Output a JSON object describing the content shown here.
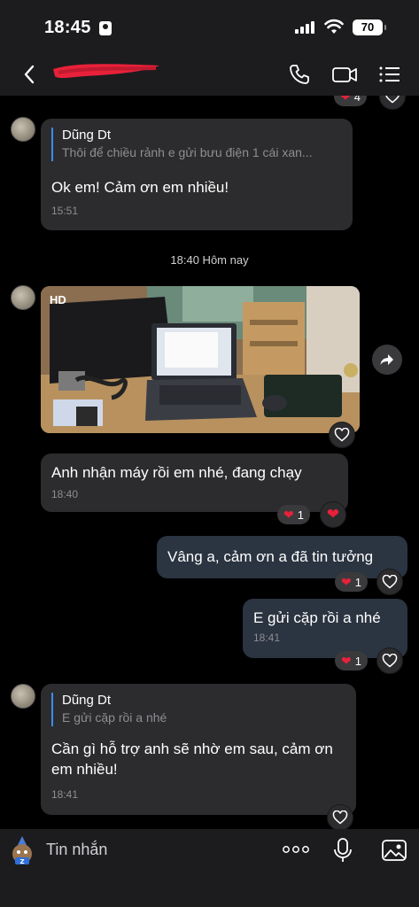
{
  "status_bar": {
    "time": "18:45",
    "battery": "70"
  },
  "header": {
    "back_icon": "chevron-left-icon",
    "contact_name": "",
    "call_icon": "phone-icon",
    "video_icon": "video-icon",
    "menu_icon": "list-icon"
  },
  "top_partial": {
    "reaction_count": "4"
  },
  "messages": [
    {
      "quote_name": "Dũng Dt",
      "quote_text": "Thôi để chiều rảnh e gửi bưu điện 1 cái xan...",
      "text": "Ok em! Cảm ơn em nhiều!",
      "time": "15:51"
    },
    {
      "day_separator": "18:40 Hôm nay"
    },
    {
      "photo_badge": "HD"
    },
    {
      "text": "Anh nhận máy rồi em nhé, đang chạy",
      "time": "18:40",
      "reaction_count": "1"
    },
    {
      "text": "Vâng a, cảm ơn a đã tin tưởng",
      "reaction_count": "1"
    },
    {
      "text": "E gửi cặp rồi a nhé",
      "time": "18:41",
      "reaction_count": "1"
    },
    {
      "quote_name": "Dũng Dt",
      "quote_text": "E gửi cặp rồi a nhé",
      "text": "Cần gì hỗ trợ anh sẽ nhờ em sau, cảm ơn em nhiều!",
      "time": "18:41"
    }
  ],
  "input": {
    "placeholder": "Tin nhắn",
    "more_icon": "more-dots-icon",
    "mic_icon": "microphone-icon",
    "image_icon": "image-icon"
  },
  "colors": {
    "background": "#000000",
    "bubble_in": "#2c2c2e",
    "bubble_out": "#2b3441",
    "quote_bar": "#3a8df5",
    "heart": "#e8213a"
  }
}
